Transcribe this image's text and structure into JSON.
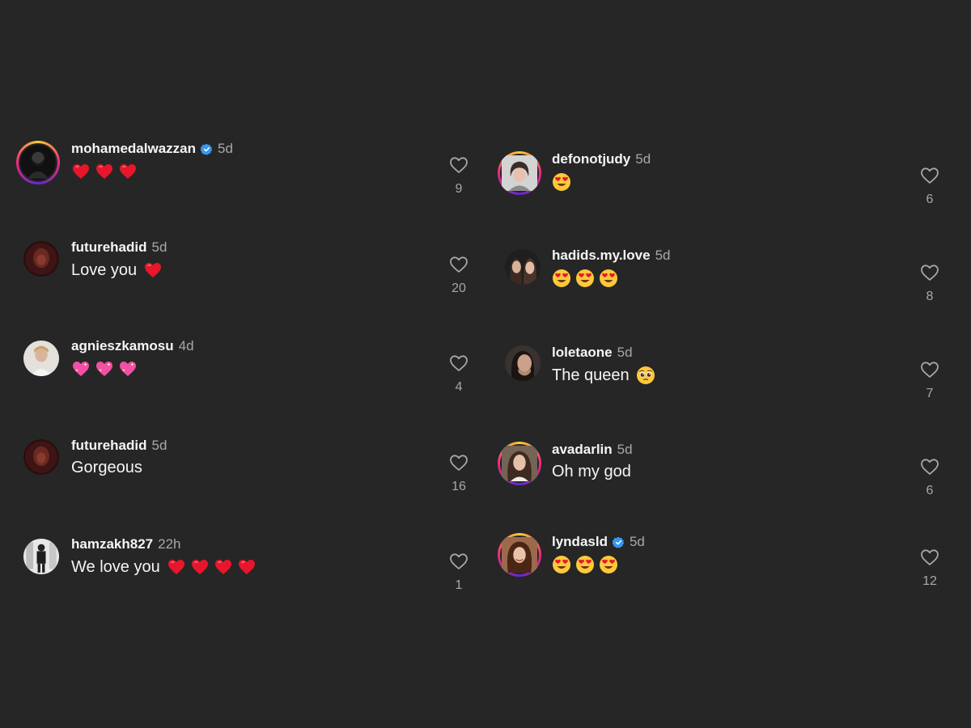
{
  "colors": {
    "background": "#262626",
    "primary_text": "#f5f5f5",
    "secondary_text": "#a8a8a8",
    "verified_badge": "#3797f0",
    "story_ring": [
      "#f9ce34",
      "#ee2a7b",
      "#6228d7"
    ]
  },
  "comments": [
    {
      "username": "mohamedalwazzan",
      "verified": true,
      "time": "5d",
      "text": "",
      "emoji": "red-heart",
      "emoji_count": 3,
      "likes": "9",
      "story_ring": true
    },
    {
      "username": "futurehadid",
      "verified": false,
      "time": "5d",
      "text": "Love you",
      "emoji": "red-heart",
      "emoji_count": 1,
      "likes": "20",
      "story_ring": false
    },
    {
      "username": "agnieszkamosu",
      "verified": false,
      "time": "4d",
      "text": "",
      "emoji": "sparkling-heart",
      "emoji_count": 3,
      "likes": "4",
      "story_ring": false
    },
    {
      "username": "futurehadid",
      "verified": false,
      "time": "5d",
      "text": "Gorgeous",
      "emoji": "",
      "emoji_count": 0,
      "likes": "16",
      "story_ring": false
    },
    {
      "username": "hamzakh827",
      "verified": false,
      "time": "22h",
      "text": "We love you",
      "emoji": "red-heart",
      "emoji_count": 4,
      "likes": "1",
      "story_ring": false
    },
    {
      "username": "defonotjudy",
      "verified": false,
      "time": "5d",
      "text": "",
      "emoji": "heart-eyes",
      "emoji_count": 1,
      "likes": "6",
      "story_ring": true
    },
    {
      "username": "hadids.my.love",
      "verified": false,
      "time": "5d",
      "text": "",
      "emoji": "heart-eyes",
      "emoji_count": 3,
      "likes": "8",
      "story_ring": false
    },
    {
      "username": "loletaone",
      "verified": false,
      "time": "5d",
      "text": "The queen",
      "emoji": "pleading-face",
      "emoji_count": 1,
      "likes": "7",
      "story_ring": false
    },
    {
      "username": "avadarlin",
      "verified": false,
      "time": "5d",
      "text": "Oh my god",
      "emoji": "",
      "emoji_count": 0,
      "likes": "6",
      "story_ring": true
    },
    {
      "username": "lyndasld",
      "verified": true,
      "time": "5d",
      "text": "",
      "emoji": "heart-eyes",
      "emoji_count": 3,
      "likes": "12",
      "story_ring": true
    }
  ],
  "icons": {
    "like": "heart-outline-icon",
    "verified": "verified-badge-icon"
  }
}
